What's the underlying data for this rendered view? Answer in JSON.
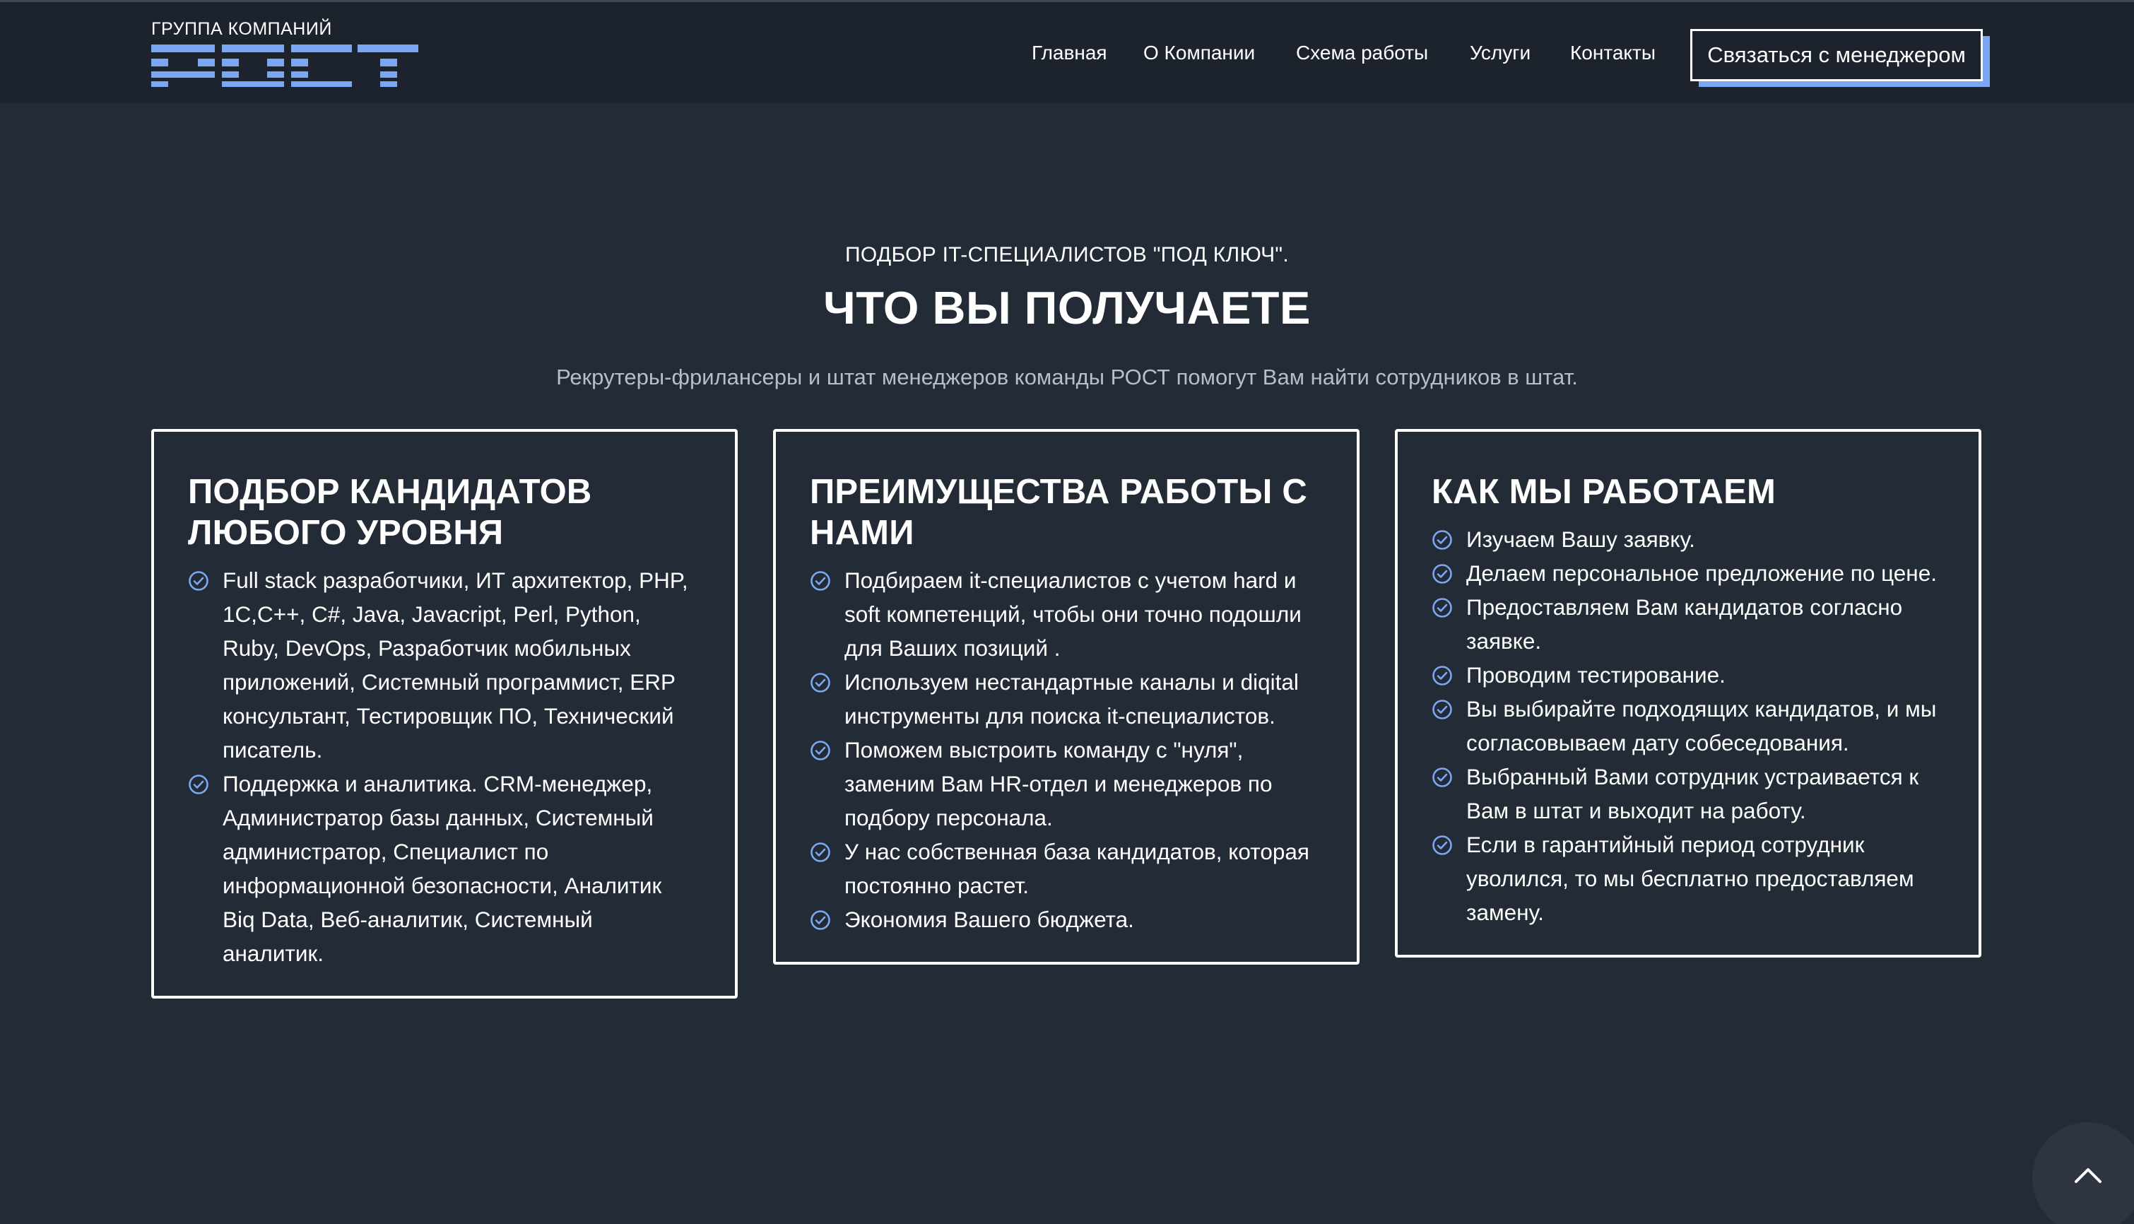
{
  "header": {
    "logo_caption": "ГРУППА КОМПАНИЙ",
    "logo_text": "РОСТ",
    "nav": [
      "Главная",
      "О Компании",
      "Схема работы",
      "Услуги",
      "Контакты"
    ],
    "cta_label": "Связаться с менеджером"
  },
  "intro": {
    "kicker": "ПОДБОР IT-СПЕЦИАЛИСТОВ \"ПОД КЛЮЧ\".",
    "title": "ЧТО ВЫ ПОЛУЧАЕТЕ",
    "subtitle": "Рекрутеры-фрилансеры и штат менеджеров команды РОСТ помогут Вам найти сотрудников в штат."
  },
  "cards": [
    {
      "title": "ПОДБОР КАНДИДАТОВ ЛЮБОГО УРОВНЯ",
      "items": [
        "Full stack разработчики, ИТ архитектор, PHP, 1С,С++, С#, Java, Javacript, Perl, Python, Ruby, DevOps, Разработчик мобильных приложений, Системный программист, ERP консультант, Тестировщик ПО, Технический писатель.",
        "Поддержка и аналитика. CRM-менеджер, Администратор базы данных, Системный администратор, Специалист по информационной безопасности, Аналитик Biq Data, Веб-аналитик, Системный аналитик."
      ]
    },
    {
      "title": "ПРЕИМУЩЕСТВА РАБОТЫ С НАМИ",
      "items": [
        "Подбираем it-специалистов с учетом hard и soft компетенций, чтобы они точно подошли для Ваших позиций .",
        "Используем нестандартные каналы и diqital инструменты для поиска it-специалистов.",
        "Поможем выстроить команду с \"нуля\", заменим Вам HR-отдел и менеджеров по подбору персонала.",
        "У нас собственная база кандидатов, которая постоянно растет.",
        "Экономия Вашего бюджета."
      ]
    },
    {
      "title": "КАК МЫ РАБОТАЕМ",
      "items": [
        "Изучаем Вашу заявку.",
        "Делаем персональное предложение по цене.",
        "Предоставляем Вам кандидатов согласно заявке.",
        "Проводим тестирование.",
        "Вы выбирайте подходящих кандидатов, и мы согласовываем дату собеседования.",
        "Выбранный Вами сотрудник устраивается к Вам в штат и выходит на работу.",
        "Если в гарантийный период сотрудник уволился, то мы бесплатно предоставляем замену."
      ]
    }
  ],
  "colors": {
    "background": "#232b37",
    "header": "#1c232d",
    "accent": "#7aa6f2",
    "muted_text": "#b8bec8"
  },
  "icons": {
    "list_bullet": "check-circle-icon",
    "scroll_top": "chevron-up-icon"
  }
}
